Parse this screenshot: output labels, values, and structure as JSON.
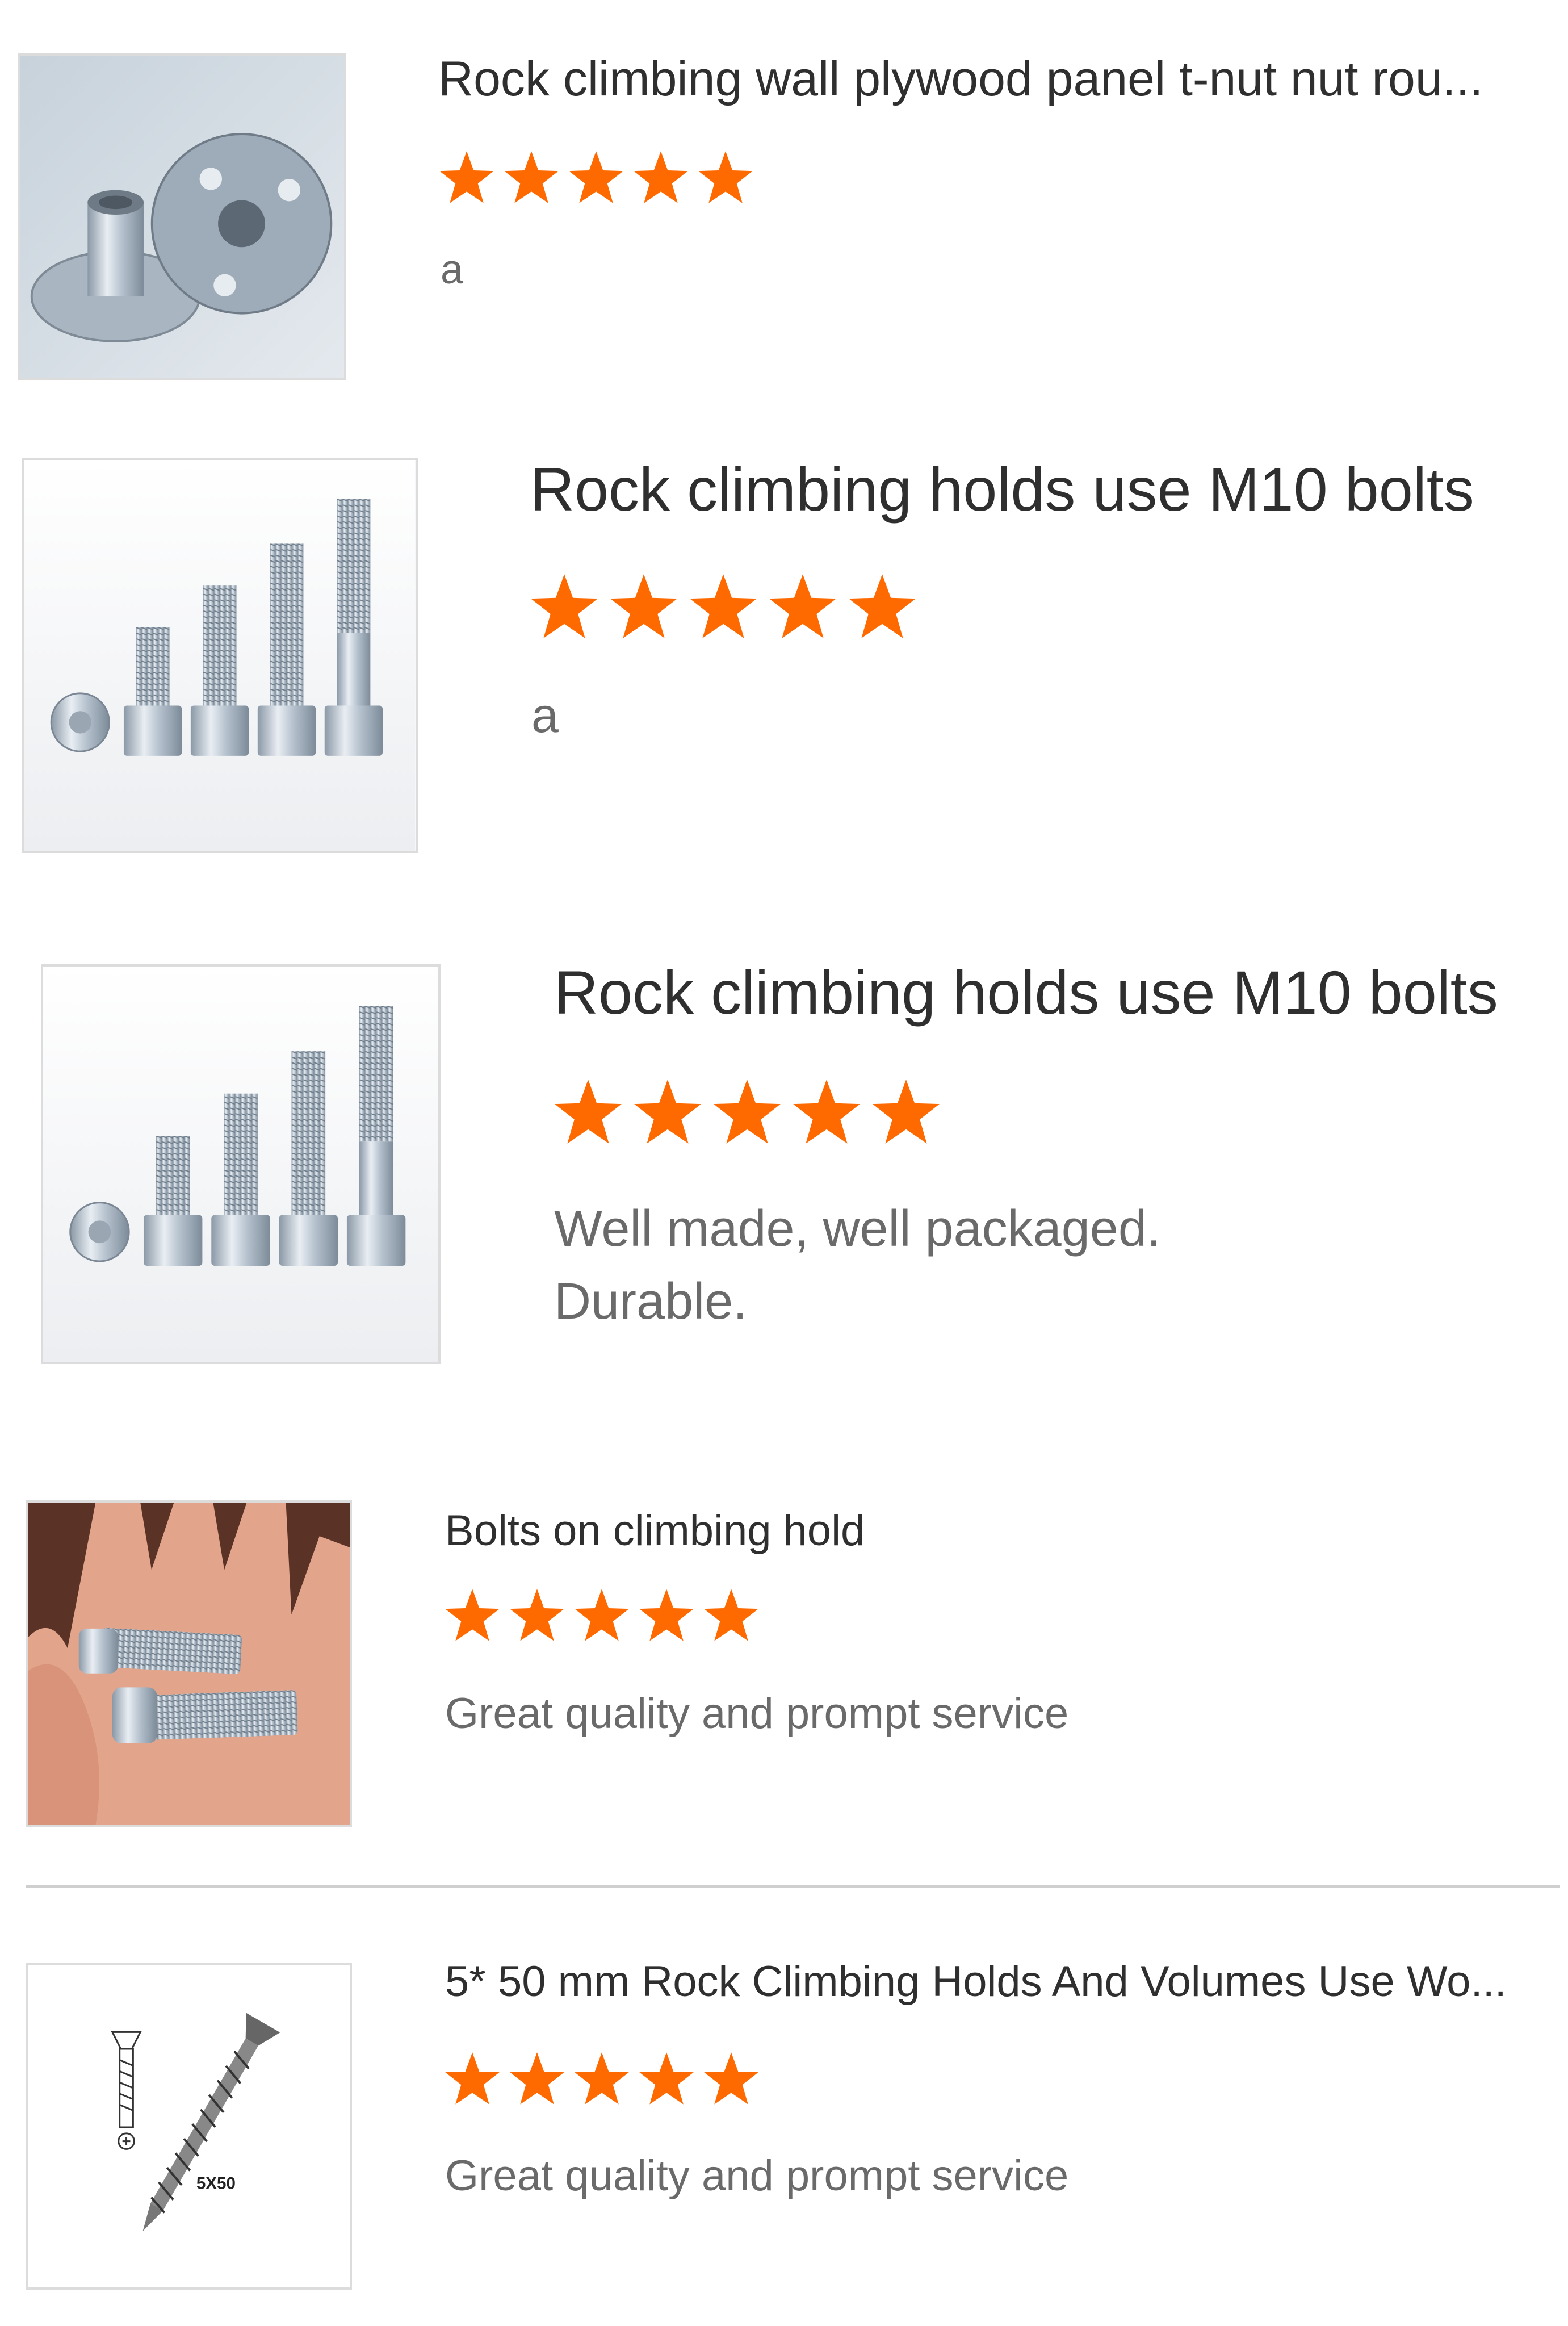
{
  "colors": {
    "star": "#ff6a00",
    "title": "#2f2f2f",
    "review": "#6a6a6a"
  },
  "reviews": [
    {
      "title": "Rock climbing wall plywood panel t-nut nut rou...",
      "rating": 5,
      "max_rating": 5,
      "text": "a",
      "image_icon": "t-nut-image"
    },
    {
      "title": "Rock climbing holds use M10 bolts",
      "rating": 5,
      "max_rating": 5,
      "text": "a",
      "image_icon": "bolts-image"
    },
    {
      "title": "Rock climbing holds use M10 bolts",
      "rating": 5,
      "max_rating": 5,
      "text": "Well made, well packaged.\nDurable.",
      "image_icon": "bolts-image"
    },
    {
      "title": "Bolts on climbing hold",
      "rating": 5,
      "max_rating": 5,
      "text": "Great quality and prompt service",
      "image_icon": "bolts-in-hand-image"
    },
    {
      "title": "5* 50 mm Rock Climbing Holds And Volumes Use Wo...",
      "rating": 5,
      "max_rating": 5,
      "text": "Great quality and prompt service",
      "image_icon": "wood-screw-image",
      "image_caption": "5X50"
    }
  ]
}
